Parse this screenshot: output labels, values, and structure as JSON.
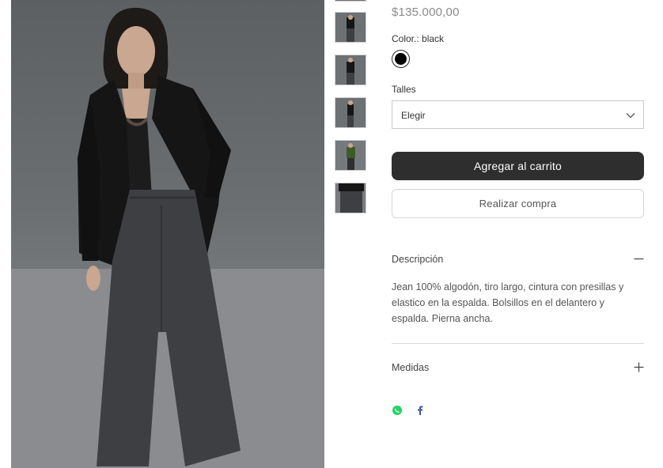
{
  "product": {
    "price": "$135.000,00",
    "color_label": "Color.: black",
    "selected_color_hex": "#000000",
    "sizes_label": "Talles",
    "size_select_value": "Elegir",
    "add_to_cart_label": "Agregar al carrito",
    "buy_now_label": "Realizar compra"
  },
  "accordion": {
    "description_title": "Descripción",
    "description_text": "Jean 100% algodón, tiro largo, cintura con presillas y elastico en la espalda. Bolsillos en el delantero y espalda. Pierna ancha.",
    "measures_title": "Medidas"
  },
  "share": {
    "icons": [
      "whatsapp-icon",
      "facebook-icon"
    ]
  },
  "colors": {
    "accent": "#2e2e2e",
    "whatsapp": "#25d366",
    "facebook": "#3b5998"
  }
}
